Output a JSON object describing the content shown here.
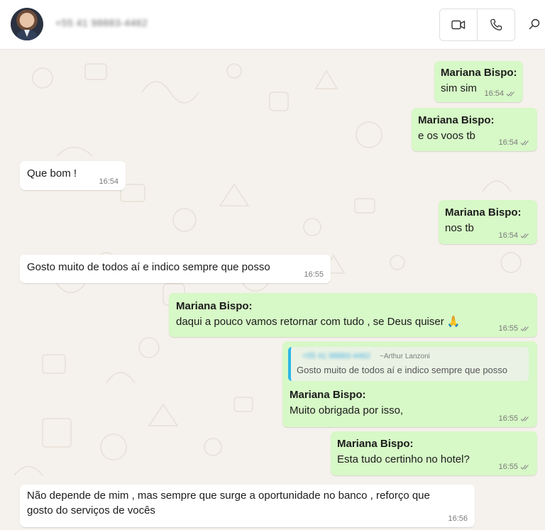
{
  "header": {
    "contact_name": "+55 41 98883-4462",
    "video_call_icon": "video-camera-icon",
    "voice_call_icon": "phone-icon",
    "search_icon": "search-icon"
  },
  "colors": {
    "outgoing_bubble": "#d7f8c7",
    "incoming_bubble": "#ffffff",
    "quote_bar": "#2db6e6",
    "wallpaper": "#f5f1ec"
  },
  "messages": [
    {
      "dir": "out",
      "sender": "Mariana Bispo:",
      "text": "sim sim",
      "time": "16:54",
      "status": "read-receipt-icon"
    },
    {
      "dir": "out",
      "sender": "Mariana Bispo:",
      "text": "e os voos tb",
      "time": "16:54",
      "status": "read-receipt-icon"
    },
    {
      "dir": "in",
      "text": "Que bom !",
      "time": "16:54"
    },
    {
      "dir": "out",
      "sender": "Mariana Bispo:",
      "text": "nos tb",
      "time": "16:54",
      "status": "read-receipt-icon"
    },
    {
      "dir": "in",
      "text": "Gosto muito de todos aí e indico sempre que posso",
      "time": "16:55"
    },
    {
      "dir": "out",
      "sender": "Mariana Bispo:",
      "text": "daqui a pouco vamos retornar com tudo , se Deus quiser 🙏",
      "time": "16:55",
      "status": "read-receipt-icon"
    },
    {
      "dir": "out",
      "quote": {
        "sender": "+55 41 98883-4462",
        "author": "~Arthur Lanzoni",
        "text": "Gosto muito de todos aí e indico sempre que posso"
      },
      "sender": "Mariana Bispo:",
      "text": "Muito obrigada por isso,",
      "time": "16:55",
      "status": "read-receipt-icon"
    },
    {
      "dir": "out",
      "sender": "Mariana Bispo:",
      "text": "Esta tudo certinho no hotel?",
      "time": "16:55",
      "status": "read-receipt-icon"
    },
    {
      "dir": "in",
      "text": "Não depende de mim , mas sempre que surge a oportunidade no banco ,  reforço que gosto do serviços de vocês",
      "time": "16:56"
    }
  ]
}
